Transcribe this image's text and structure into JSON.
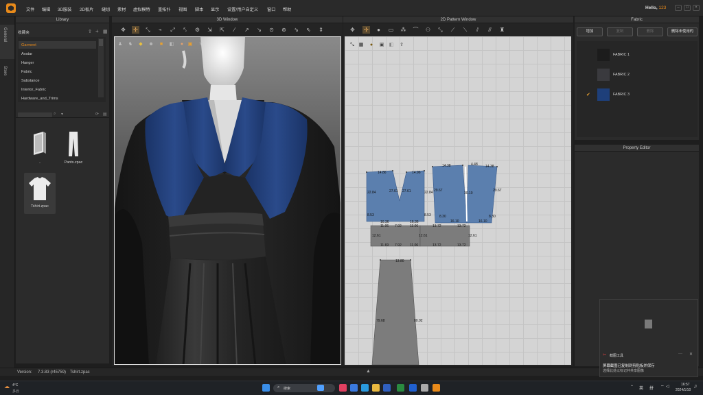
{
  "menu": [
    "文件",
    "编辑",
    "3D服装",
    "2D板片",
    "缝纫",
    "素材",
    "虚拟模特",
    "重拓扑",
    "视图",
    "脚本",
    "显示",
    "设置/用户自定义",
    "窗口",
    "帮助"
  ],
  "greeting": {
    "prefix": "Hello, ",
    "user": "123"
  },
  "side_tabs": [
    "General",
    "Store"
  ],
  "library": {
    "title": "Library",
    "favorites": "收藏夹",
    "items": [
      "Garment",
      "Avatar",
      "Hanger",
      "Fabric",
      "Substance",
      "Interior_Fabric",
      "Hardware_and_Trims"
    ],
    "files": [
      "..",
      "Pants.zpac",
      "Tshirt.zpac"
    ]
  },
  "window3d": {
    "title": "3D Window"
  },
  "window2d": {
    "title": "2D Pattern Window"
  },
  "measurements": {
    "bodice_left": [
      "14.86",
      "14.96",
      "22.84",
      "27.61",
      "27.61",
      "22.84",
      "8.53",
      "8.53",
      "16.36",
      "16.36",
      "7.92",
      "11.06",
      "11.06"
    ],
    "bodice_right": [
      "14.38",
      "14.38",
      "4.48",
      "29.67",
      "29.67",
      "30.10",
      "8.30",
      "8.30",
      "16.10",
      "16.10",
      "13.72",
      "13.72"
    ],
    "belt": [
      "12.61",
      "12.61",
      "11.69",
      "7.92",
      "11.06",
      "13.72",
      "13.72",
      "12.61"
    ],
    "skirt": [
      "13.80",
      "79.68",
      "80.02"
    ]
  },
  "fabric": {
    "title": "Fabric",
    "buttons": [
      "增加",
      "复制",
      "删除",
      "删除未使用的"
    ],
    "items": [
      {
        "name": "FABRIC 1",
        "color": "#1c1c1c",
        "checked": false
      },
      {
        "name": "FABRIC 2",
        "color": "#3a3a3e",
        "checked": false
      },
      {
        "name": "FABRIC 3",
        "color": "#1e3f7a",
        "checked": true
      }
    ]
  },
  "property_editor": {
    "title": "Property Editor"
  },
  "status": {
    "version_label": "Version:",
    "version": "7.3.83 (r45759)",
    "file": "Tshirt.zpac"
  },
  "notification": {
    "app": "截图工具",
    "line1": "屏幕截图已复制到剪贴板并保存",
    "line2": "选择此处以标记并共享图像"
  },
  "taskbar": {
    "temp": "4°C",
    "weather": "多云",
    "search": "搜索",
    "lang": "英",
    "ime": "拼",
    "time": "16:57",
    "date": "2024/1/10"
  },
  "colors": {
    "accent": "#e88a1a",
    "pattern_blue": "#5b7fae",
    "pattern_grey": "#7c7c7c",
    "garment_blue": "#1f3c78"
  }
}
